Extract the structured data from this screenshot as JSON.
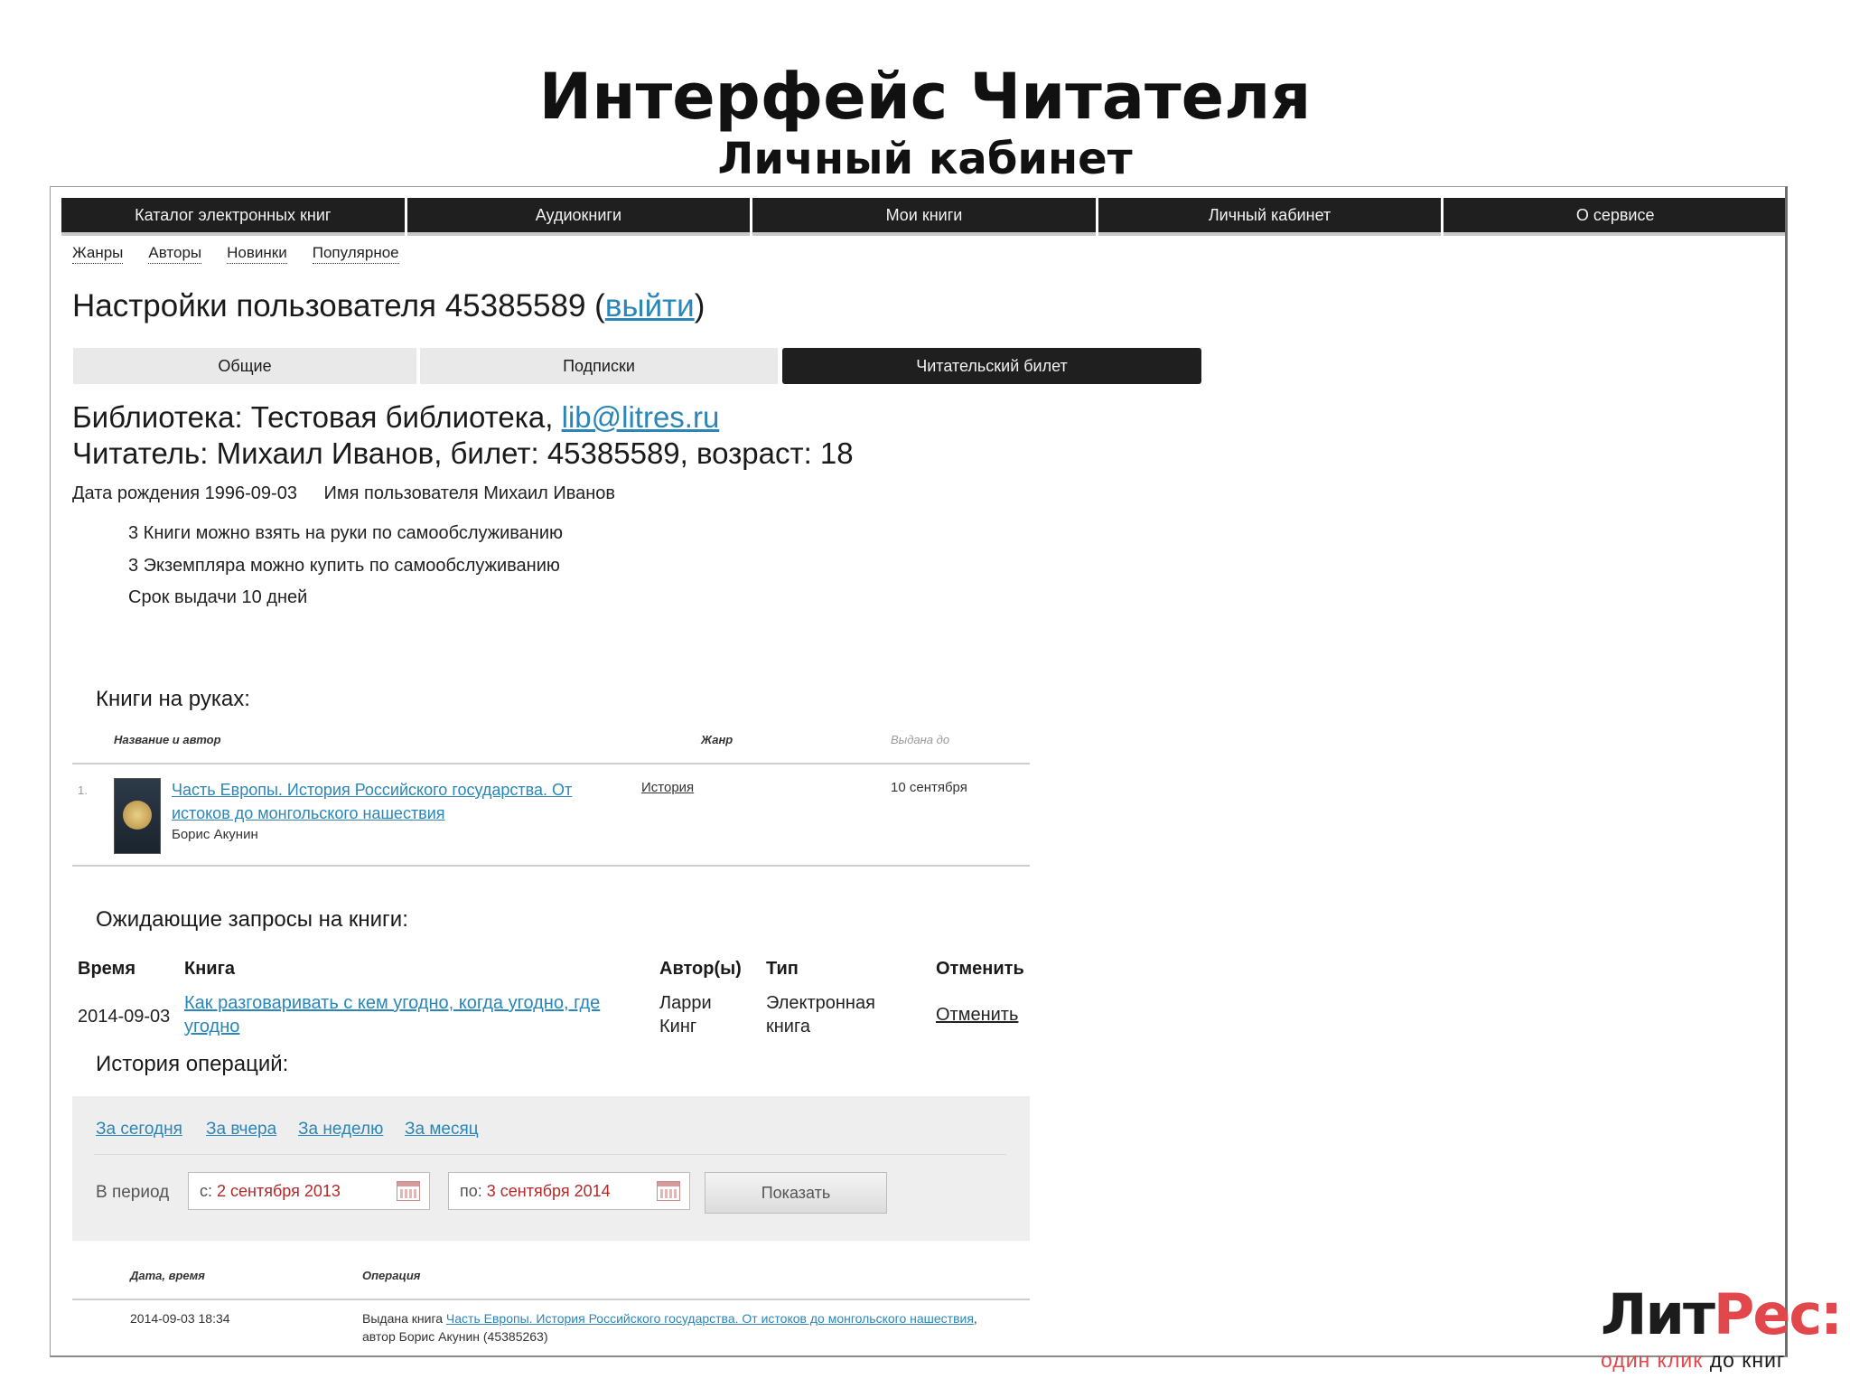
{
  "slide": {
    "title": "Интерфейс Читателя",
    "subtitle": "Личный кабинет"
  },
  "topnav": [
    "Каталог электронных книг",
    "Аудиокниги",
    "Мои книги",
    "Личный кабинет",
    "О сервисе"
  ],
  "subnav": [
    "Жанры",
    "Авторы",
    "Новинки",
    "Популярное"
  ],
  "settings": {
    "title_prefix": "Настройки пользователя 45385589 (",
    "logout_label": "выйти",
    "title_suffix": ")"
  },
  "tabs": {
    "items": [
      "Общие",
      "Подписки",
      "Читательский билет"
    ],
    "active": "Читательский билет"
  },
  "library": {
    "prefix": "Библиотека: Тестовая библиотека, ",
    "email": "lib@litres.ru"
  },
  "reader": {
    "line": "Читатель: Михаил Иванов, билет: 45385589, возраст: 18",
    "birth_date": "Дата рождения 1996-09-03",
    "username": "Имя пользователя Михаил Иванов"
  },
  "rules": [
    "3 Книги можно взять на руки по самообслуживанию",
    "3 Экземпляра можно купить по самообслуживанию",
    "Срок выдачи 10 дней"
  ],
  "books_on_hand": {
    "title": "Книги на руках:",
    "headers": {
      "name": "Название и автор",
      "genre": "Жанр",
      "due": "Выдана до"
    },
    "rows": [
      {
        "index": "1.",
        "title_line1": "Часть Европы. История Российского государства. От",
        "title_line2": "истоков до монгольского нашествия",
        "author": "Борис Акунин",
        "genre": "История",
        "due": "10 сентября"
      }
    ]
  },
  "pending_requests": {
    "title": "Ожидающие запросы на книги:",
    "headers": {
      "time": "Время",
      "book": "Книга",
      "authors": "Автор(ы)",
      "type": "Тип",
      "cancel": "Отменить"
    },
    "rows": [
      {
        "time": "2014-09-03",
        "book_line1": "Как разговаривать с кем угодно, когда угодно, где",
        "book_line2": "угодно",
        "author_line1": "Ларри",
        "author_line2": "Кинг",
        "type_line1": "Электронная",
        "type_line2": "книга",
        "cancel": "Отменить"
      }
    ]
  },
  "history": {
    "title": "История операций:",
    "period_links": [
      "За сегодня",
      "За вчера",
      "За неделю",
      "За месяц"
    ],
    "period_label": "В период",
    "from": {
      "prefix": "с:",
      "value": "2 сентября 2013"
    },
    "to": {
      "prefix": "по:",
      "value": "3 сентября 2014"
    },
    "show_label": "Показать",
    "headers": {
      "datetime": "Дата, время",
      "operation": "Операция"
    },
    "rows": [
      {
        "datetime": "2014-09-03 18:34",
        "op_prefix": "Выдана книга ",
        "op_link": "Часть Европы. История Российского государства. От истоков до монгольского нашествия",
        "op_suffix": ", автор Борис Акунин (45385263)"
      }
    ]
  },
  "logo": {
    "part1": "Лит",
    "part2": "Рес:",
    "tagline1": "один клик",
    "tagline2": " до книг"
  },
  "colors": {
    "nav_bg": "#1f1f1f",
    "link": "#2a86b8",
    "date_value": "#b02a2a",
    "brand_red": "#e2474b"
  }
}
